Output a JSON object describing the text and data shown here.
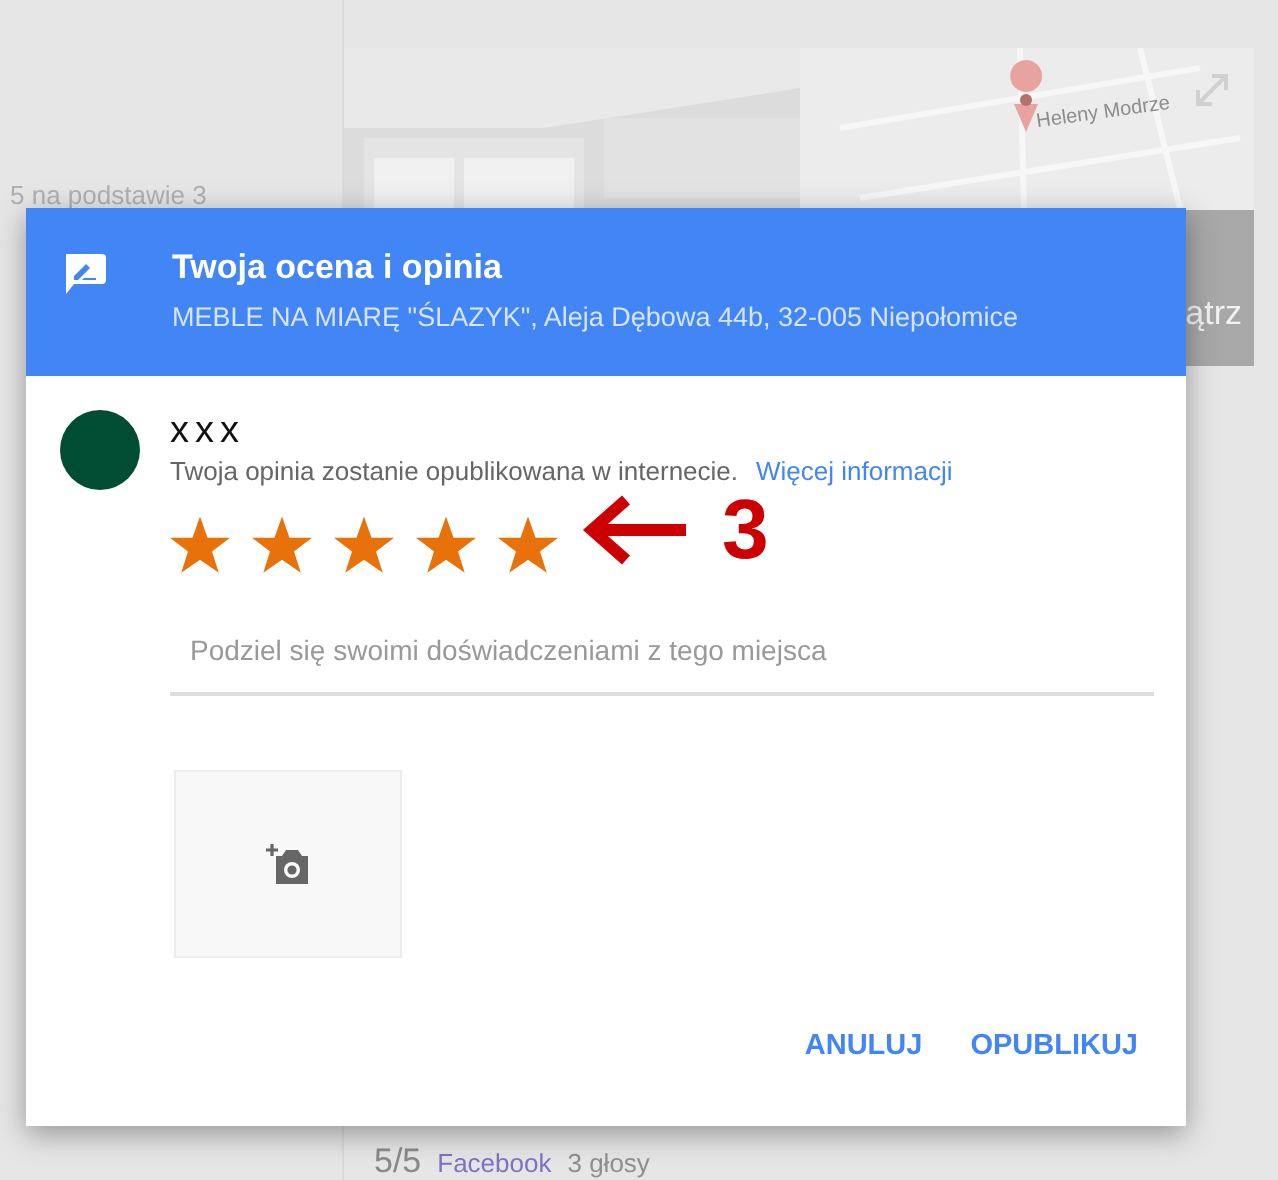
{
  "background": {
    "rating_summary": "5 na podstawie 3",
    "map_street": "Heleny Modrze",
    "photos_button": "ątrz",
    "source": {
      "score": "5/5",
      "name": "Facebook",
      "votes": "3 głosy"
    }
  },
  "dialog": {
    "title": "Twoja ocena i opinia",
    "subtitle": "MEBLE NA MIARĘ \"ŚLAZYK\", Aleja Dębowa 44b, 32-005 Niepołomice",
    "user": {
      "name": "xxx"
    },
    "notice": "Twoja opinia zostanie opublikowana w internecie.",
    "link": "Więcej informacji",
    "rating": {
      "stars": 5
    },
    "annotation": "3",
    "review": {
      "placeholder": "Podziel się swoimi doświadczeniami z tego miejsca"
    },
    "buttons": [
      "ANULUJ",
      "OPUBLIKUJ"
    ]
  }
}
